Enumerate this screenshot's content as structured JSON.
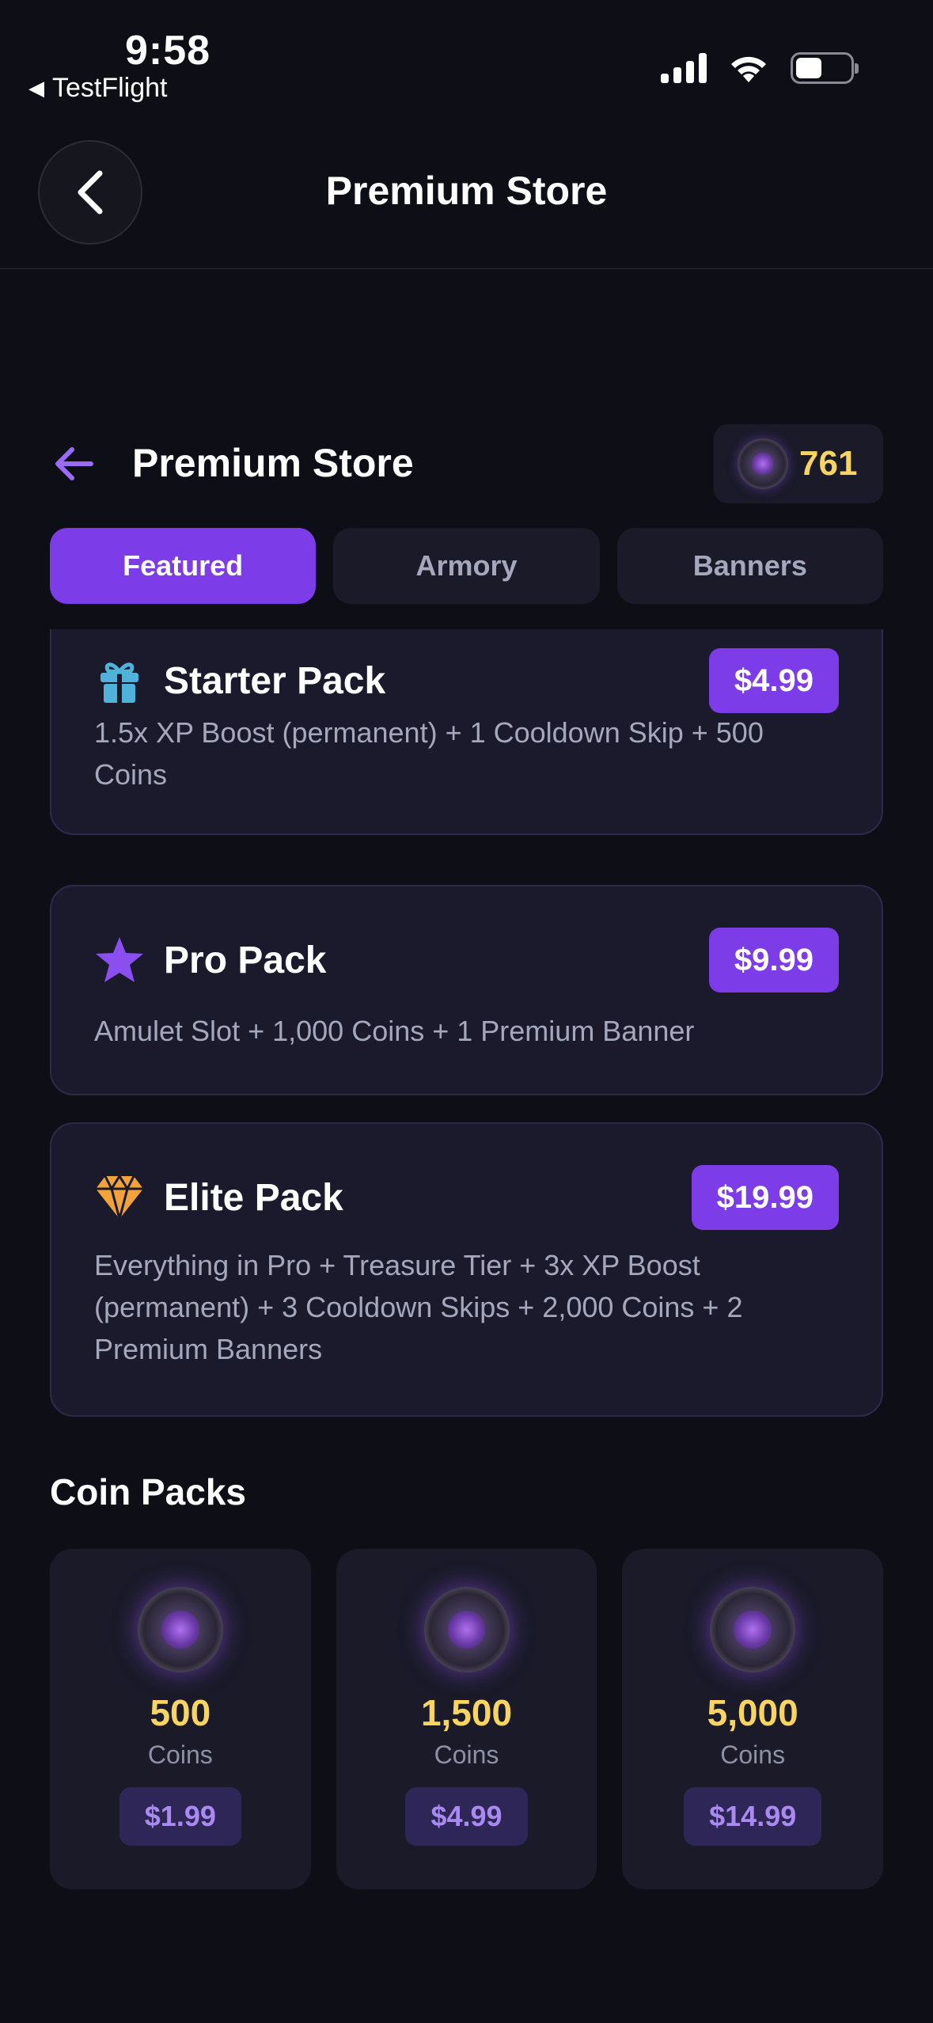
{
  "status_bar": {
    "time": "9:58",
    "back_app": "TestFlight"
  },
  "nav": {
    "title": "Premium Store"
  },
  "store": {
    "title": "Premium Store",
    "coin_balance": "761"
  },
  "tabs": [
    {
      "label": "Featured",
      "active": true
    },
    {
      "label": "Armory",
      "active": false
    },
    {
      "label": "Banners",
      "active": false
    }
  ],
  "packs": [
    {
      "name": "Starter Pack",
      "icon": "gift-icon",
      "price": "$4.99",
      "description": "1.5x XP Boost (permanent) + 1 Cooldown Skip + 500 Coins"
    },
    {
      "name": "Pro Pack",
      "icon": "star-icon",
      "price": "$9.99",
      "description": "Amulet Slot + 1,000 Coins + 1 Premium Banner"
    },
    {
      "name": "Elite Pack",
      "icon": "diamond-icon",
      "price": "$19.99",
      "description": "Everything in Pro + Treasure Tier + 3x XP Boost (permanent) + 3 Cooldown Skips + 2,000 Coins + 2 Premium Banners"
    }
  ],
  "coin_packs": {
    "title": "Coin Packs",
    "items": [
      {
        "amount": "500",
        "unit": "Coins",
        "price": "$1.99"
      },
      {
        "amount": "1,500",
        "unit": "Coins",
        "price": "$4.99"
      },
      {
        "amount": "5,000",
        "unit": "Coins",
        "price": "$14.99"
      }
    ]
  },
  "colors": {
    "background": "#0e0e17",
    "card": "#1a1a2c",
    "accent_purple": "#7c3ce8",
    "coin_gold": "#f7d560",
    "muted_text": "#a5a8bd",
    "gift": "#4fb3d9",
    "star": "#8b4ff0",
    "diamond": "#f2a23a"
  }
}
